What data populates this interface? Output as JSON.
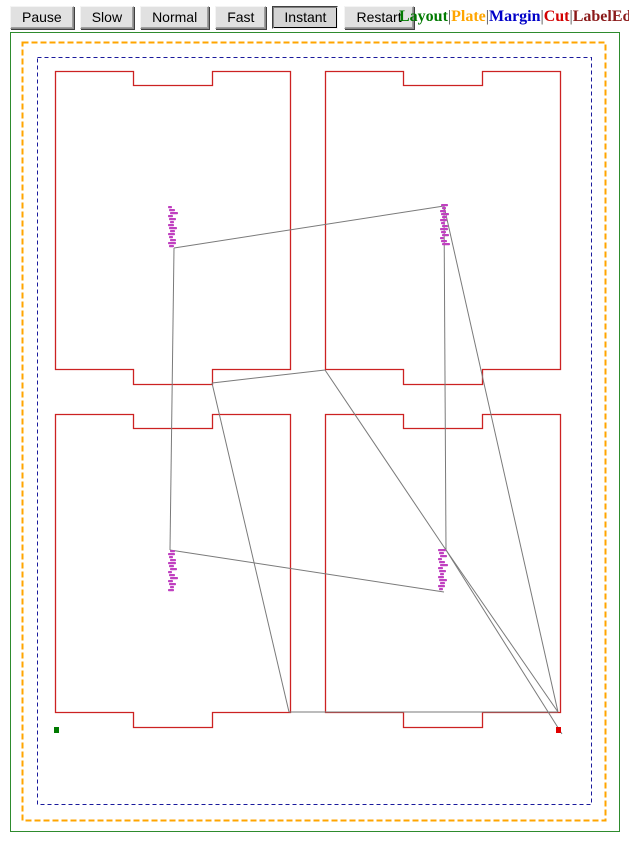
{
  "toolbar": {
    "buttons": [
      {
        "key": "pause",
        "label": "Pause",
        "pressed": false
      },
      {
        "key": "slow",
        "label": "Slow",
        "pressed": false
      },
      {
        "key": "normal",
        "label": "Normal",
        "pressed": false
      },
      {
        "key": "fast",
        "label": "Fast",
        "pressed": false
      },
      {
        "key": "instant",
        "label": "Instant",
        "pressed": true
      },
      {
        "key": "restart",
        "label": "Restart",
        "pressed": false
      }
    ]
  },
  "legend": {
    "items": [
      {
        "key": "layout",
        "label": "Layout",
        "color": "#007a00"
      },
      {
        "key": "plate",
        "label": "Plate",
        "color": "#ffa500"
      },
      {
        "key": "margin",
        "label": "Margin",
        "color": "#0000c8"
      },
      {
        "key": "cut",
        "label": "Cut",
        "color": "#d20000"
      },
      {
        "key": "labeledge",
        "label": "LabelEd",
        "color": "#8b1a1a"
      }
    ],
    "separator": "|"
  },
  "colors": {
    "layout": "#2e8b2e",
    "plate": "#ffa500",
    "margin": "#1a1a9c",
    "cut": "#cc2222",
    "travel": "#7a7a7a",
    "engrave": "#c040c0",
    "start_marker": "#007a00",
    "end_marker": "#e00000"
  }
}
